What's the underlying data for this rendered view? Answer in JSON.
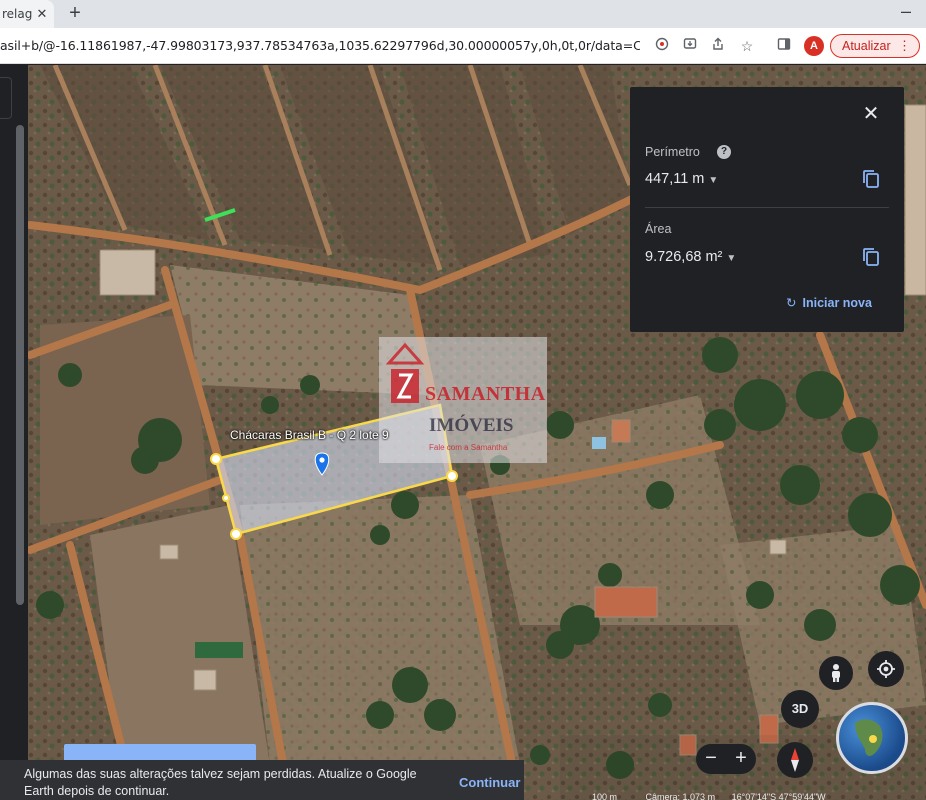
{
  "browser": {
    "tab_title": "relag",
    "url": "asil+b/@-16.11861987,-47.99803173,937.78534763a,1035.62297796d,30.00000057y,0h,0t,0r/data=Ci...",
    "avatar_letter": "A",
    "update_label": "Atualizar",
    "accent_color": "#d93025"
  },
  "measurement": {
    "perimeter_label": "Perímetro",
    "perimeter_value": "447,11 m",
    "area_label": "Área",
    "area_value": "9.726,68 m²",
    "new_measure_label": "Iniciar nova"
  },
  "map": {
    "place_label": "Chácaras Brasil B - Q 2 lote 9",
    "watermark_brand": "SAMANTHA",
    "watermark_sub": "IMÓVEIS",
    "watermark_small": "Fale com a Samantha",
    "button_3d": "3D",
    "polygon_color": "#f9d949"
  },
  "toast": {
    "message": "Algumas das suas alterações talvez sejam perdidas. Atualize o Google Earth depois de continuar.",
    "action": "Continuar"
  },
  "status_bar": {
    "scale": "100 m",
    "camera": "Câmera: 1.073 m",
    "coords": "16°07'14\"S 47°59'44\"W"
  }
}
